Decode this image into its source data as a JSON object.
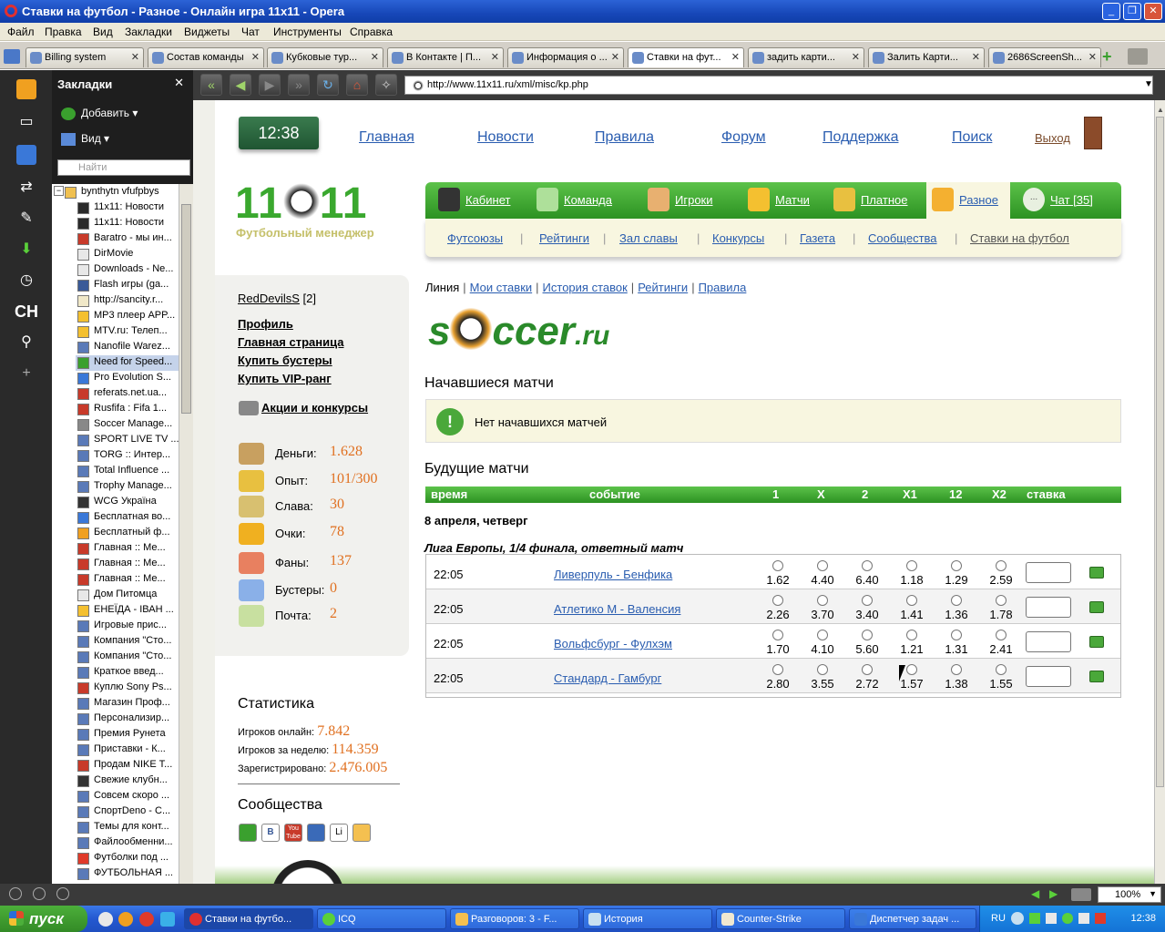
{
  "window": {
    "title": "Ставки на футбол - Разное - Онлайн игра 11х11 - Opera"
  },
  "menu": [
    "Файл",
    "Правка",
    "Вид",
    "Закладки",
    "Виджеты",
    "Чат",
    "Инструменты",
    "Справка"
  ],
  "tabs": [
    "Billing system",
    "Состав команды",
    "Кубковые тур...",
    "В Контакте | П...",
    "Информация о ...",
    "Ставки на фут...",
    "задить карти...",
    "Залить Карти...",
    "2686ScreenSh..."
  ],
  "bookmarks_panel": {
    "title": "Закладки",
    "add_label": "Добавить",
    "view_label": "Вид",
    "search_placeholder": "Найти",
    "folder": "bynthytn vfufpbys",
    "items": [
      "11x11: Новости",
      "11x11: Новости",
      "Baratro - мы ин...",
      "DirMovie",
      "Downloads - Ne...",
      "Flash игры (ga...",
      "http://sancity.r...",
      "MP3 плеер APP...",
      "MTV.ru: Телеп...",
      "Nanofile Warez...",
      "Need for Speed...",
      "Pro Evolution S...",
      "referats.net.ua...",
      "Rusfifa : Fifa 1...",
      "Soccer Manage...",
      "SPORT LIVE TV ...",
      "TORG :: Интер...",
      "Total Influence ...",
      "Trophy Manage...",
      "WCG Україна",
      "Бесплатная во...",
      "Бесплатный ф...",
      "Главная :: Ме...",
      "Главная :: Ме...",
      "Главная :: Ме...",
      "Дом Питомца",
      "ЕНЕЇДА - ІВАН ...",
      "Игровые прис...",
      "Компания \"Сто...",
      "Компания \"Сто...",
      "Краткое введ...",
      "Куплю Sony Ps...",
      "Магазин Проф...",
      "Персонализир...",
      "Премия Рунета",
      "Приставки - К...",
      "Продам NIKE T...",
      "Свежие клубн...",
      "Совсем скоро ...",
      "СпортDeno - С...",
      "Темы для конт...",
      "Файлообменни...",
      "Футболки под ...",
      "ФУТБОЛЬНАЯ ..."
    ]
  },
  "address": {
    "url": "http://www.11x11.ru/xml/misc/kp.php"
  },
  "site": {
    "clock": "12:38",
    "topnav": [
      "Главная",
      "Новости",
      "Правила",
      "Форум",
      "Поддержка",
      "Поиск"
    ],
    "exit_label": "Выход",
    "logo_left": "11",
    "logo_right": "11",
    "logo_sub": "Футбольный менеджер",
    "mainnav": [
      "Кабинет",
      "Команда",
      "Игроки",
      "Матчи",
      "Платное",
      "Разное",
      "Чат [35]"
    ],
    "chat_bubble": "...",
    "subnav": [
      "Футсоюзы",
      "Рейтинги",
      "Зал славы",
      "Конкурсы",
      "Газета",
      "Сообщества",
      "Ставки на футбол"
    ],
    "subnav_sep": "|",
    "user": {
      "name": "RedDevilsS",
      "level": "[2]"
    },
    "userlinks": [
      "Профиль",
      "Главная страница",
      "Купить бустеры",
      "Купить VIP-ранг"
    ],
    "promo": "Акции и конкурсы",
    "stats": [
      {
        "label": "Деньги:",
        "value": "1.628"
      },
      {
        "label": "Опыт:",
        "value": "101/300"
      },
      {
        "label": "Слава:",
        "value": "30"
      },
      {
        "label": "Очки:",
        "value": "78"
      },
      {
        "label": "Фаны:",
        "value": "137"
      },
      {
        "label": "Бустеры:",
        "value": "0"
      },
      {
        "label": "Почта:",
        "value": "2"
      }
    ],
    "statistics": {
      "title": "Статистика",
      "rows": [
        {
          "label": "Игроков онлайн:",
          "value": "7.842"
        },
        {
          "label": "Игроков за неделю:",
          "value": "114.359"
        },
        {
          "label": "Зарегистрировано:",
          "value": "2.476.005"
        }
      ]
    },
    "communities": {
      "title": "Сообщества",
      "icons": [
        "В",
        "You Tube",
        "Li"
      ]
    }
  },
  "betting": {
    "tabs": {
      "current": "Линия",
      "links": [
        "Мои ставки",
        "История ставок",
        "Рейтинги",
        "Правила"
      ],
      "sep": "|"
    },
    "partner_logo": {
      "s": "s",
      "rest": "ccer",
      "suffix": ".ru"
    },
    "started_title": "Начавшиеся матчи",
    "started_mark": "!",
    "started_empty": "Нет начавшихся матчей",
    "future_title": "Будущие матчи",
    "columns": [
      "время",
      "событие",
      "1",
      "X",
      "2",
      "X1",
      "12",
      "X2",
      "ставка"
    ],
    "date": "8 апреля, четверг",
    "league": "Лига Европы, 1/4 финала, ответный матч",
    "matches": [
      {
        "time": "22:05",
        "event": "Ливерпуль - Бенфика",
        "odds": [
          "1.62",
          "4.40",
          "6.40",
          "1.18",
          "1.29",
          "2.59"
        ]
      },
      {
        "time": "22:05",
        "event": "Атлетико М - Валенсия",
        "odds": [
          "2.26",
          "3.70",
          "3.40",
          "1.41",
          "1.36",
          "1.78"
        ]
      },
      {
        "time": "22:05",
        "event": "Вольфсбург - Фулхэм",
        "odds": [
          "1.70",
          "4.10",
          "5.60",
          "1.21",
          "1.31",
          "2.41"
        ]
      },
      {
        "time": "22:05",
        "event": "Стандард - Гамбург",
        "odds": [
          "2.80",
          "3.55",
          "2.72",
          "1.57",
          "1.38",
          "1.55"
        ]
      }
    ]
  },
  "statusbar": {
    "zoom": "100%"
  },
  "taskbar": {
    "start": "пуск",
    "tasks": [
      "Ставки на футбо...",
      "ICQ",
      "Разговоров: 3 - F...",
      "История",
      "Counter-Strike",
      "Диспетчер задач ..."
    ],
    "lang": "RU",
    "clock": "12:38"
  }
}
